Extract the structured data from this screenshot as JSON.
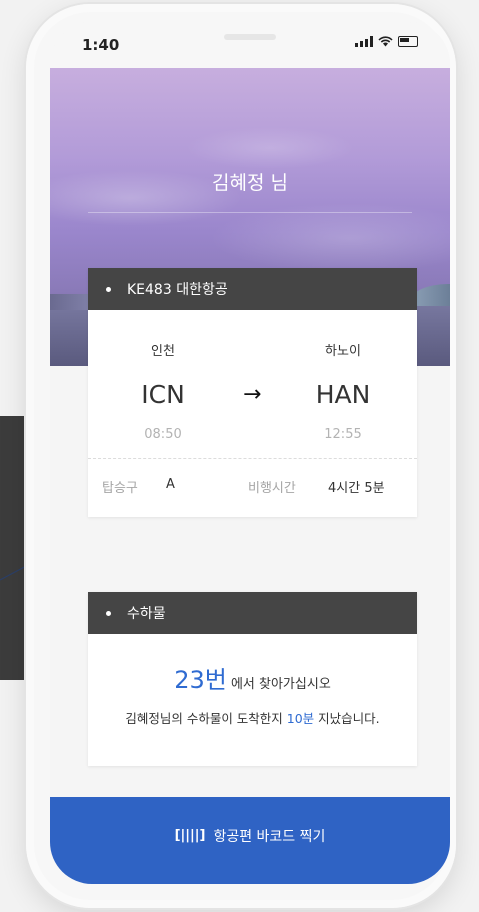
{
  "status_bar": {
    "time": "1:40"
  },
  "hero": {
    "greeting": "김혜정 님"
  },
  "flight": {
    "header": "KE483 대한항공",
    "departure": {
      "city": "인천",
      "code": "ICN",
      "time": "08:50"
    },
    "arrival": {
      "city": "하노이",
      "code": "HAN",
      "time": "12:55"
    },
    "arrow": "→",
    "gate_label": "탑승구",
    "gate_value": "A",
    "duration_label": "비행시간",
    "duration_value": "4시간 5분"
  },
  "baggage": {
    "header": "수하물",
    "carousel": "23번",
    "carousel_suffix": " 에서 찾아가십시오",
    "message_prefix": "김혜정님의 수하물이 도착한지 ",
    "elapsed": "10분",
    "message_suffix": " 지났습니다."
  },
  "action": {
    "barcode_icon": "[||||]",
    "barcode_label": "항공편 바코드 찍기"
  },
  "colors": {
    "accent": "#2f63c4",
    "highlight": "#2f6bd1",
    "card_header": "#454545"
  }
}
